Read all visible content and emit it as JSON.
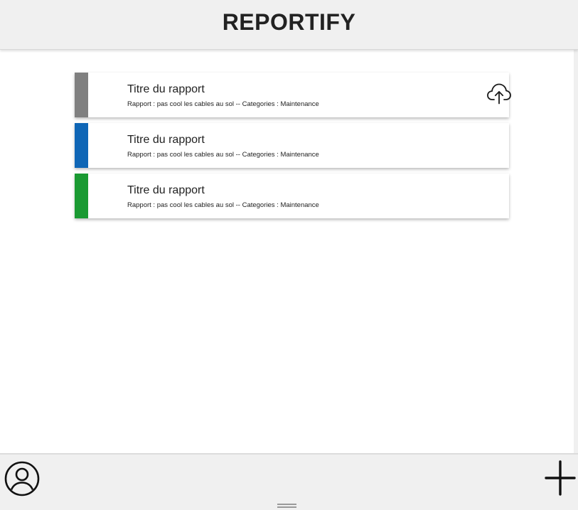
{
  "header": {
    "title": "REPORTIFY"
  },
  "reports": [
    {
      "title": "Titre du rapport",
      "description": "Rapport : pas cool les cables au sol -- Categories : Maintenance",
      "color": "#808080",
      "icon": "cloud-upload-icon"
    },
    {
      "title": "Titre du rapport",
      "description": "Rapport : pas cool les cables au sol -- Categories : Maintenance",
      "color": "#0f66b6"
    },
    {
      "title": "Titre du rapport",
      "description": "Rapport : pas cool les cables au sol -- Categories : Maintenance",
      "color": "#1a9a32"
    }
  ],
  "footer": {
    "account_icon": "account-circle-icon",
    "add_icon": "plus-icon"
  },
  "colors": {
    "header_bg": "#f0f0f0",
    "footer_bg": "#f0f0f0",
    "text": "#222222"
  }
}
